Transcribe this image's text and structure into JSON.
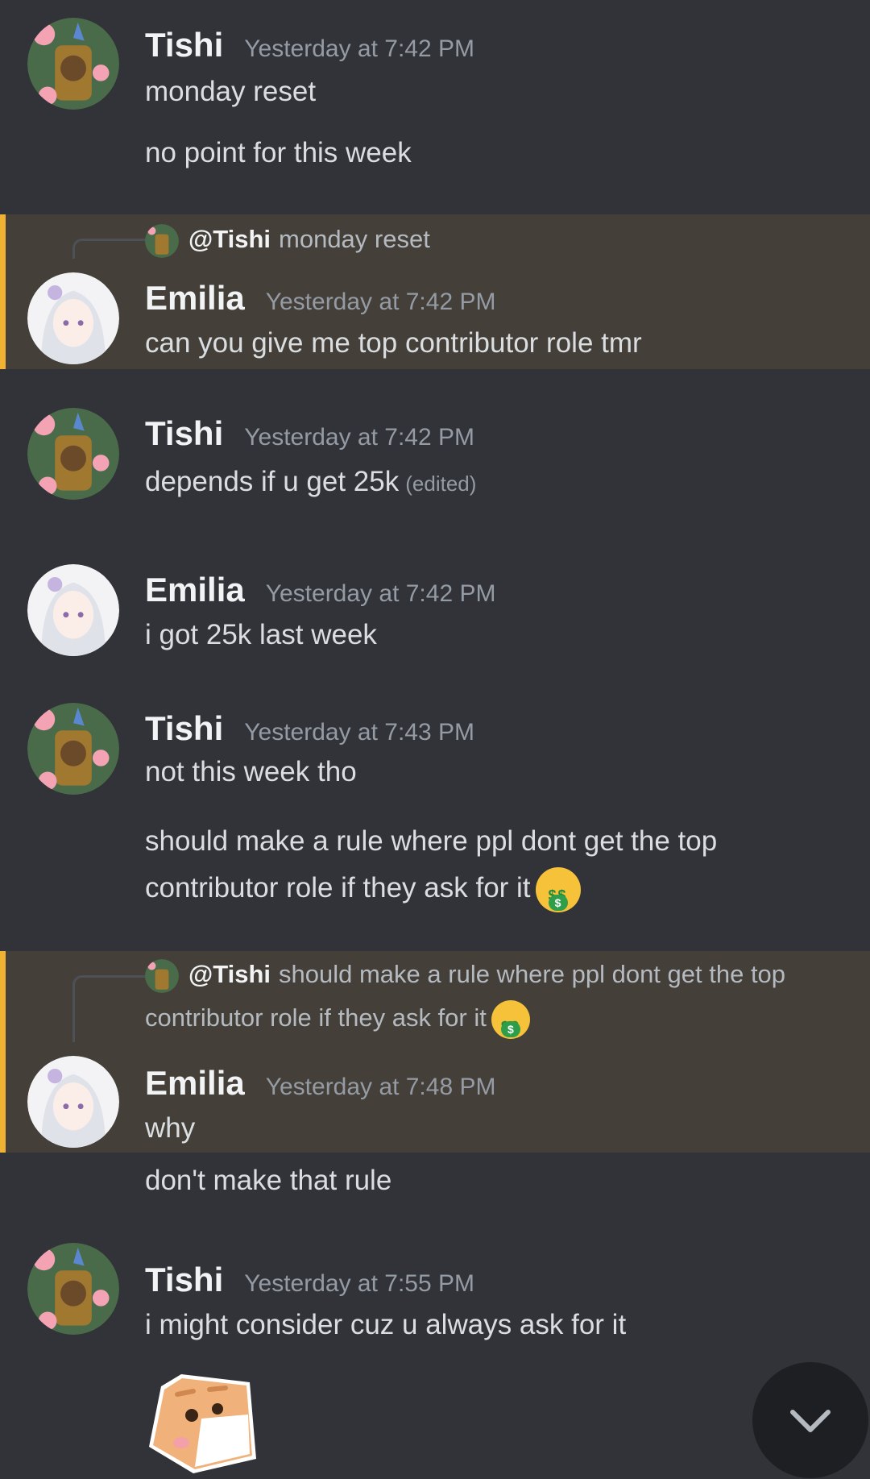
{
  "messages": [
    {
      "author": "Tishi",
      "time": "Yesterday at 7:42 PM",
      "lines": [
        "monday reset",
        "no point for this week"
      ]
    },
    {
      "author": "Emilia",
      "time": "Yesterday at 7:42 PM",
      "reply": {
        "mention": "@Tishi",
        "text": "monday reset"
      },
      "lines": [
        "can you give me top contributor role tmr"
      ]
    },
    {
      "author": "Tishi",
      "time": "Yesterday at 7:42 PM",
      "lines": [
        "depends if u get 25k"
      ],
      "edited": "(edited)"
    },
    {
      "author": "Emilia",
      "time": "Yesterday at 7:42 PM",
      "lines": [
        "i got 25k last week"
      ]
    },
    {
      "author": "Tishi",
      "time": "Yesterday at 7:43 PM",
      "lines": [
        "not this week tho",
        "should make a rule where ppl dont get the top",
        "contributor role if they ask for it"
      ]
    },
    {
      "author": "Emilia",
      "time": "Yesterday at 7:48 PM",
      "reply": {
        "mention": "@Tishi",
        "text_line1": "should make a rule where ppl dont get the top",
        "text_line2": "contributor role if they ask for it"
      },
      "lines": [
        "why",
        "don't make that rule"
      ]
    },
    {
      "author": "Tishi",
      "time": "Yesterday at 7:55 PM",
      "lines": [
        "i might consider cuz u always ask for it"
      ]
    }
  ],
  "emoji": "money-mouth-face",
  "sticker": "cat-sticker",
  "jump_button_icon": "chevron-down-icon",
  "colors": {
    "background": "#313338",
    "mention_highlight": "#444039",
    "mention_bar": "#f0b232"
  }
}
